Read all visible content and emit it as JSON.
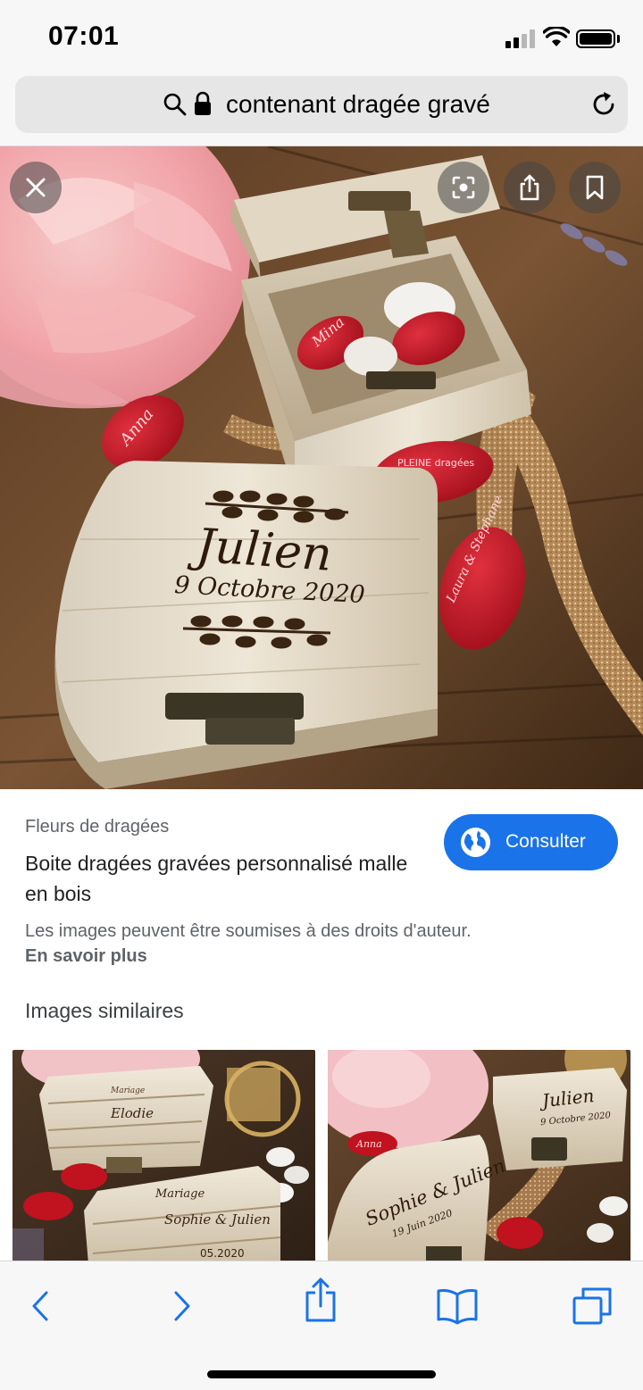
{
  "status_bar": {
    "time": "07:01"
  },
  "browser": {
    "address": "contenant dragée gravé",
    "accent_color": "#1a73e8"
  },
  "image_viewer": {
    "overlay_buttons": [
      "close-icon",
      "lens-icon",
      "share-icon",
      "bookmark-icon"
    ],
    "engraving": {
      "name": "Julien",
      "date": "9 Octobre 2020",
      "stone_1": "Anna",
      "stone_2": "Mina",
      "stone_3": "PLEINE dragées",
      "stone_4": "Laura & Stephane"
    }
  },
  "result": {
    "source": "Fleurs de dragées",
    "title": "Boite dragées gravées personnalisé malle en bois",
    "consult_label": "Consulter",
    "copyright_notice": "Les images peuvent être soumises à des droits d'auteur.",
    "learn_more": "En savoir plus"
  },
  "similar": {
    "heading": "Images similaires",
    "thumb_1": {
      "box_top": "Elodie",
      "box_top_sub": "Mariage",
      "lid_title": "Mariage",
      "names": "Sophie & Julien",
      "date": "05.2020"
    },
    "thumb_2": {
      "name": "Julien",
      "date": "9 Octobre 2020",
      "names": "Sophie & Julien",
      "date2": "19 Juin 2020",
      "stone": "Anna"
    }
  },
  "toolbar": {
    "items": [
      "back-icon",
      "forward-icon",
      "share-icon",
      "bookmarks-icon",
      "tabs-icon"
    ]
  }
}
